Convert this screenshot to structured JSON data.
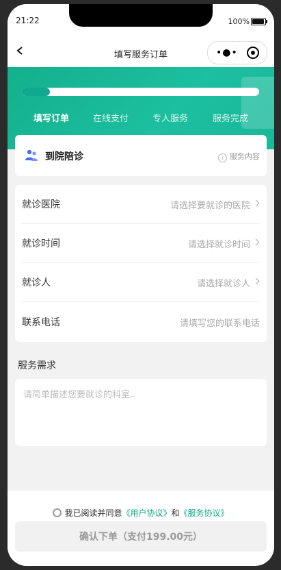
{
  "status_bar": {
    "time": "21:22",
    "battery": "100%"
  },
  "nav": {
    "title": "填写服务订单"
  },
  "progress": {
    "value": 0.12
  },
  "steps": [
    "填写订单",
    "在线支付",
    "专人服务",
    "服务完成"
  ],
  "service": {
    "title": "到院陪诊",
    "info": "服务内容"
  },
  "form": {
    "rows": [
      {
        "label": "就诊医院",
        "placeholder": "请选择要就诊的医院"
      },
      {
        "label": "就诊时间",
        "placeholder": "请选择就诊时间"
      },
      {
        "label": "就诊人",
        "placeholder": "请选择就诊人"
      },
      {
        "label": "联系电话",
        "placeholder": "请填写您的联系电话"
      }
    ]
  },
  "requirements": {
    "title": "服务需求",
    "placeholder": "请简单描述您要就诊的科室.."
  },
  "agreement": {
    "prefix": "我已阅读并同意",
    "user": "《用户协议》",
    "and": "和",
    "service": "《服务协议》"
  },
  "submit": {
    "label": "确认下单（支付199.00元）"
  },
  "colors": {
    "brand": "#13b08c",
    "link": "#10a88e"
  }
}
